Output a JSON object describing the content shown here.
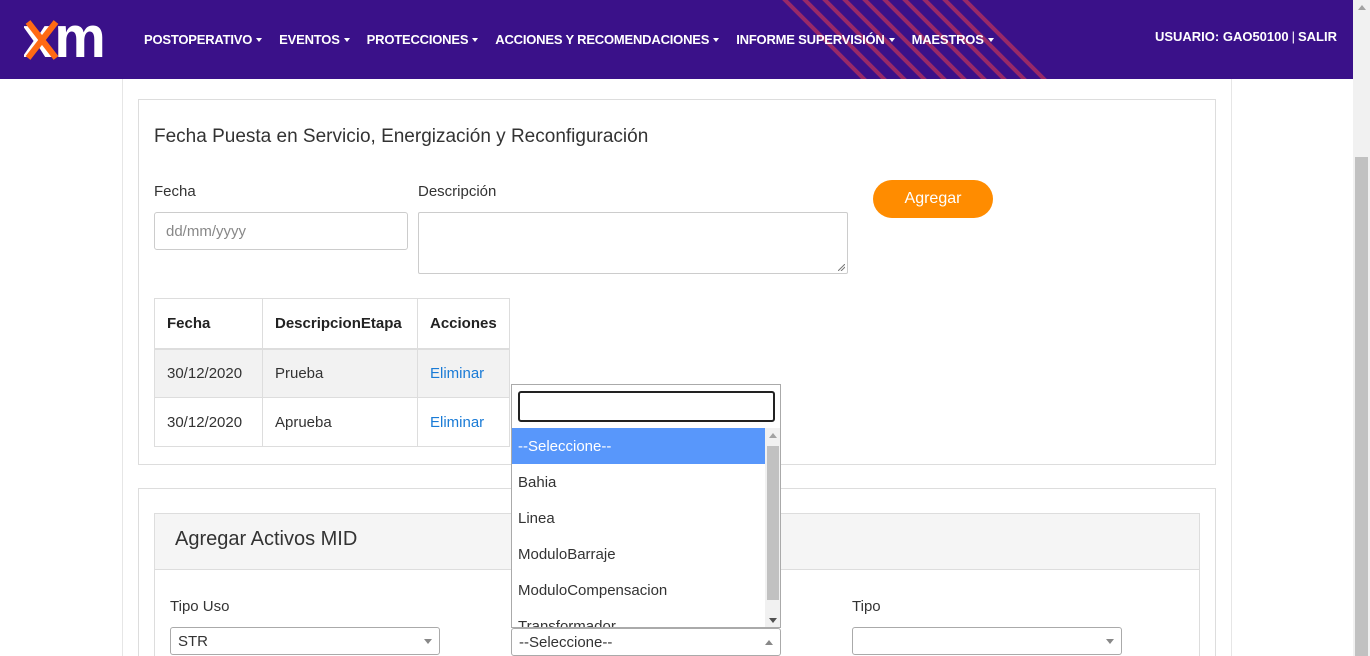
{
  "nav": {
    "brand": "xm",
    "items": [
      {
        "label": "POSTOPERATIVO"
      },
      {
        "label": "EVENTOS"
      },
      {
        "label": "PROTECCIONES"
      },
      {
        "label": "ACCIONES Y RECOMENDACIONES"
      },
      {
        "label": "INFORME SUPERVISIÓN"
      },
      {
        "label": "MAESTROS"
      }
    ],
    "user_label": "USUARIO: GAO50100",
    "separator": "|",
    "logout": "SALIR",
    "colors": {
      "background": "#3a1189",
      "accent": "#ff6a13"
    }
  },
  "fechas_card": {
    "title": "Fecha Puesta en Servicio, Energización y Reconfiguración",
    "fecha_label": "Fecha",
    "fecha_placeholder": "dd/mm/yyyy",
    "descripcion_label": "Descripción",
    "add_button": "Agregar",
    "table": {
      "headers": [
        "Fecha",
        "DescripcionEtapa",
        "Acciones"
      ],
      "rows": [
        {
          "fecha": "30/12/2020",
          "descripcion": "Prueba",
          "accion": "Eliminar"
        },
        {
          "fecha": "30/12/2020",
          "descripcion": "Aprueba",
          "accion": "Eliminar"
        }
      ]
    }
  },
  "activos_card": {
    "title": "Agregar Activos MID",
    "tipo_uso_label": "Tipo Uso",
    "tipo_uso_value": "STR",
    "middle_select_value": "--Seleccione--",
    "tipo_label": "Tipo",
    "tipo_value": ""
  },
  "dropdown": {
    "search_value": "",
    "options": [
      {
        "label": "--Seleccione--",
        "selected": true
      },
      {
        "label": "Bahia"
      },
      {
        "label": "Linea"
      },
      {
        "label": "ModuloBarraje"
      },
      {
        "label": "ModuloCompensacion"
      },
      {
        "label": "Transformador"
      }
    ]
  }
}
